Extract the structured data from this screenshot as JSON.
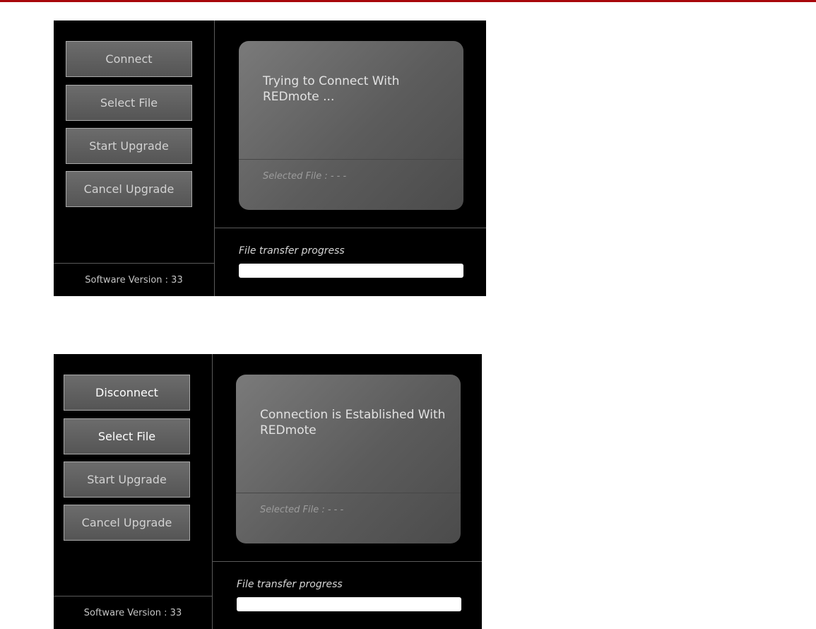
{
  "screens": [
    {
      "buttons": {
        "connect_label": "Connect",
        "select_file_label": "Select File",
        "start_upgrade_label": "Start Upgrade",
        "cancel_upgrade_label": "Cancel Upgrade"
      },
      "status_message": "Trying to Connect With REDmote ...",
      "selected_file": "Selected File : - - -",
      "progress_label": "File transfer progress",
      "progress_fraction": 0,
      "software_version": "Software Version : 33"
    },
    {
      "buttons": {
        "connect_label": "Disconnect",
        "select_file_label": "Select File",
        "start_upgrade_label": "Start Upgrade",
        "cancel_upgrade_label": "Cancel Upgrade"
      },
      "status_message": "Connection is Established With REDmote",
      "selected_file": "Selected File : - - -",
      "progress_label": "File transfer progress",
      "progress_fraction": 0,
      "software_version": "Software Version : 33"
    }
  ],
  "colors": {
    "top_rule": "#a8070b",
    "panel_background": "#000000",
    "button_border": "#a9a9a9"
  }
}
